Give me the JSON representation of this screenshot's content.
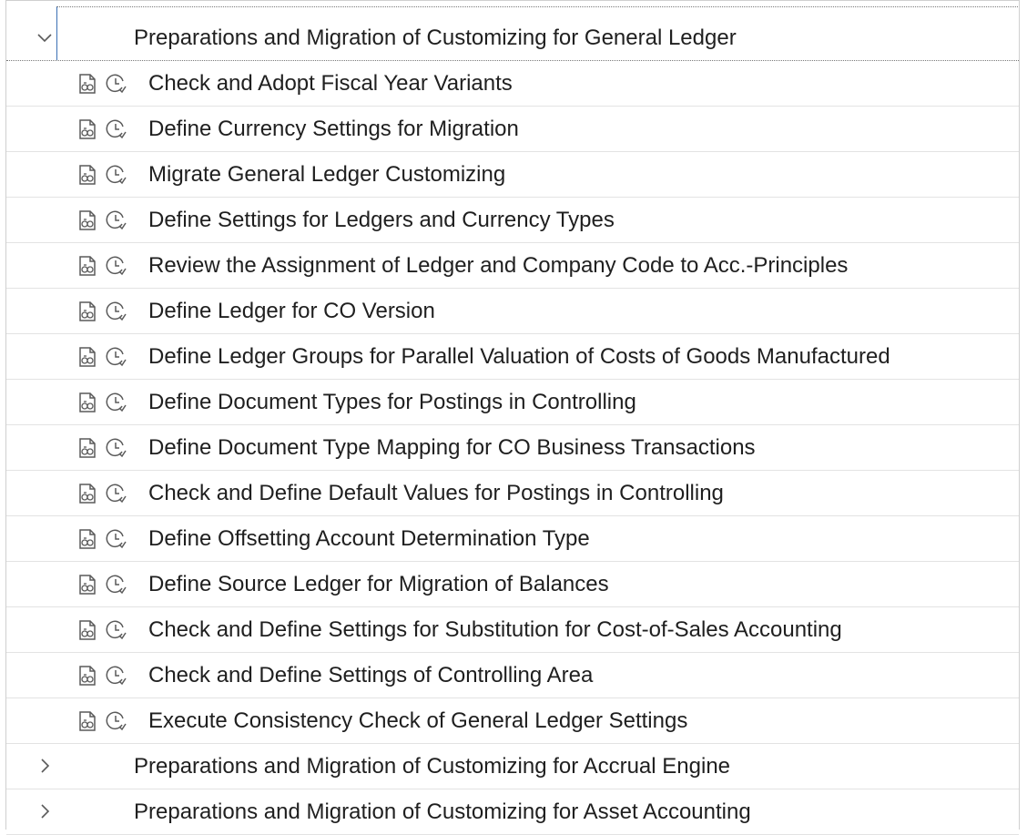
{
  "tree": {
    "groups": [
      {
        "label": "Preparations and Migration of Customizing for General Ledger",
        "expanded": true,
        "chevron_icon": "chevron-down-icon",
        "children": [
          {
            "label": "Check and Adopt Fiscal Year Variants"
          },
          {
            "label": "Define Currency Settings for Migration"
          },
          {
            "label": "Migrate General Ledger Customizing"
          },
          {
            "label": "Define Settings for Ledgers and Currency Types"
          },
          {
            "label": "Review the Assignment of Ledger and Company Code to Acc.-Principles"
          },
          {
            "label": "Define Ledger for CO Version"
          },
          {
            "label": "Define Ledger Groups for Parallel Valuation of Costs of Goods Manufactured"
          },
          {
            "label": "Define Document Types for Postings in Controlling"
          },
          {
            "label": "Define Document Type Mapping for CO Business Transactions"
          },
          {
            "label": "Check and Define Default Values for Postings in Controlling"
          },
          {
            "label": "Define Offsetting Account Determination Type"
          },
          {
            "label": "Define Source Ledger for Migration of Balances"
          },
          {
            "label": "Check and Define Settings for Substitution for Cost-of-Sales Accounting"
          },
          {
            "label": "Check and Define Settings of Controlling Area"
          },
          {
            "label": "Execute Consistency Check of General Ledger Settings"
          }
        ]
      },
      {
        "label": "Preparations and Migration of Customizing for Accrual Engine",
        "expanded": false,
        "chevron_icon": "chevron-right-icon"
      },
      {
        "label": "Preparations and Migration of Customizing for Asset Accounting",
        "expanded": false,
        "chevron_icon": "chevron-right-icon"
      }
    ],
    "child_icons": [
      "documentation-icon",
      "execute-status-icon"
    ]
  },
  "colors": {
    "text": "#1f1f1f",
    "icon": "#5a5a5a",
    "row_border": "#e3e3e3",
    "focus_border": "#3b6fb5"
  }
}
